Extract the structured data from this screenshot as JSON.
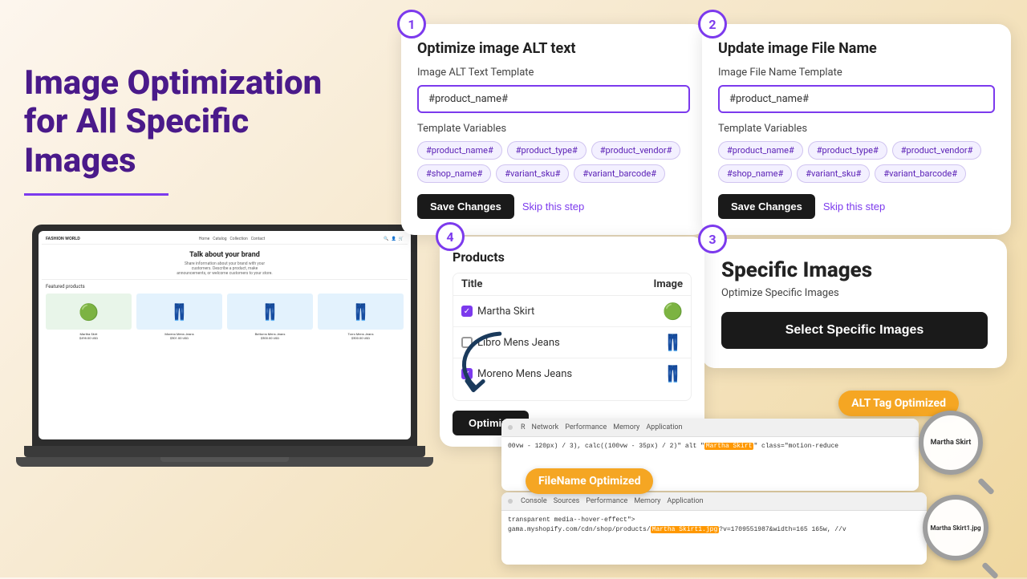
{
  "page": {
    "background": "#f5e6c8",
    "title": "Image Optimization for All Specific Images"
  },
  "left": {
    "title_line1": "Image Optimization",
    "title_line2": "for All Specific Images"
  },
  "shop_mockup": {
    "logo": "FASHION WORLD",
    "nav_links": [
      "Home",
      "Catalog",
      "Collection",
      "Contact"
    ],
    "hero_title": "Talk about your brand",
    "hero_desc": "Share information about your brand with your customers. Describe a product, make announcements, or welcome customers to your store.",
    "featured_title": "Featured products",
    "products": [
      {
        "name": "Martha Skirt",
        "price": "$498.00 USD",
        "emoji": "🟢",
        "bg": "skirt-bg"
      },
      {
        "name": "Moreno Mens Jeans",
        "price": "$501.00 USD",
        "emoji": "👖",
        "bg": "jeans-bg"
      },
      {
        "name": "Bottoms Mens Jeans",
        "price": "$500.00 USD",
        "emoji": "👖",
        "bg": "jeans-bg"
      },
      {
        "name": "Torro Mens Jeans",
        "price": "$500.00 USD",
        "emoji": "👖",
        "bg": "jeans-bg"
      }
    ]
  },
  "step1": {
    "badge": "1",
    "title": "Optimize image ALT text",
    "alt_text_label": "Image ALT Text Template",
    "alt_text_value": "#product_name#",
    "template_vars_label": "Template Variables",
    "template_vars": [
      "#product_name#",
      "#product_type#",
      "#product_vendor#",
      "#shop_name#",
      "#variant_sku#",
      "#variant_barcode#"
    ],
    "save_label": "Save Changes",
    "skip_label": "Skip this step"
  },
  "step2": {
    "badge": "2",
    "title": "Update image File Name",
    "file_name_label": "Image File Name Template",
    "file_name_value": "#product_name#",
    "template_vars_label": "Template Variables",
    "template_vars": [
      "#product_name#",
      "#product_type#",
      "#product_vendor#",
      "#shop_name#",
      "#variant_sku#",
      "#variant_barcode#"
    ],
    "save_label": "Save Changes",
    "skip_label": "Skip this step"
  },
  "step3": {
    "badge": "3",
    "title": "Specific Images",
    "subtitle": "Optimize Specific Images",
    "button_label": "Select Specific Images"
  },
  "step4": {
    "badge": "4",
    "title": "Products",
    "col_title": "Title",
    "col_image": "Image",
    "products": [
      {
        "name": "Martha Skirt",
        "checked": true,
        "emoji": "🟢"
      },
      {
        "name": "Libro Mens Jeans",
        "checked": false,
        "emoji": "👖"
      },
      {
        "name": "Moreno Mens Jeans",
        "checked": true,
        "emoji": "👖"
      }
    ],
    "optimize_label": "Optimize"
  },
  "screenshots": {
    "alt_badge": "ALT Tag Optimized",
    "filename_badge": "FileName Optimized",
    "top_tabs": [
      "R",
      "Network",
      "Performance",
      "Memory",
      "Application"
    ],
    "top_content_pre": "00vw - 120px) / 3), calc((100vw - 35px) / 2)\" alt \"",
    "top_highlight": "Martha Skirt",
    "top_content_post": "class=\"motion-reduce",
    "bottom_tabs": [
      "Console",
      "Sources",
      "Performance",
      "Memory",
      "Application"
    ],
    "bottom_content_pre": "transparent media--hover-effect\">\ngama.myshopify.com/cdn/shop/products/",
    "bottom_highlight": "Martha Skirt1.jpg",
    "bottom_content_post": "v=1709551987&width=165 165w, //v"
  }
}
